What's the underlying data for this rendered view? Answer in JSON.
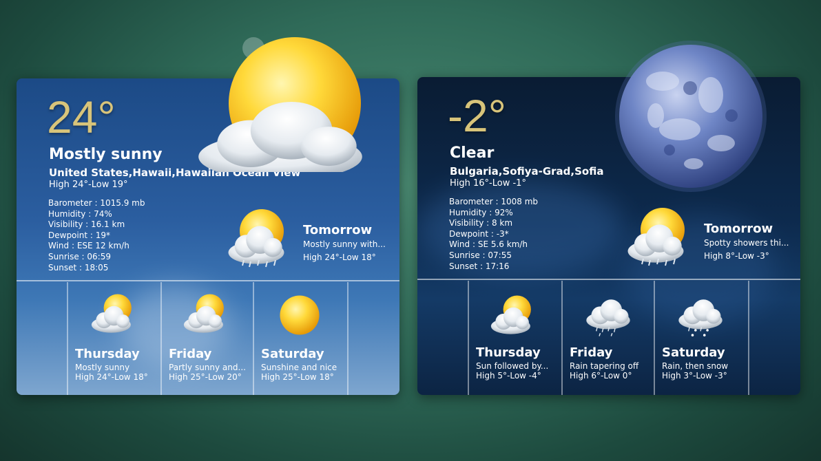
{
  "widgets": [
    {
      "temp": "24°",
      "condition": "Mostly sunny",
      "location": "United States,Hawaii,Hawaiian Ocean View",
      "high_low": "High 24°-Low 19°",
      "details": [
        "Barometer : 1015.9 mb",
        "Humidity : 74%",
        "Visibility : 16.1 km",
        "Dewpoint : 19*",
        "Wind : ESE 12 km/h",
        "Sunrise : 06:59",
        "Sunset : 18:05"
      ],
      "main_icon": "sun-cloud-icon",
      "tomorrow": {
        "title": "Tomorrow",
        "desc": "Mostly sunny with...",
        "high_low": "High 24°-Low 18°",
        "icon": "sun-cloud-rain-icon"
      },
      "forecast": [
        {
          "day": "Thursday",
          "desc": "Mostly sunny",
          "high_low": "High 24°-Low 18°",
          "icon": "sun-cloud-icon"
        },
        {
          "day": "Friday",
          "desc": "Partly sunny and...",
          "high_low": "High 25°-Low 20°",
          "icon": "sun-cloud-icon"
        },
        {
          "day": "Saturday",
          "desc": "Sunshine and nice",
          "high_low": "High 25°-Low 18°",
          "icon": "sun-icon"
        }
      ]
    },
    {
      "temp": "-2°",
      "condition": "Clear",
      "location": "Bulgaria,Sofiya-Grad,Sofia",
      "high_low": "High 16°-Low -1°",
      "details": [
        "Barometer : 1008 mb",
        "Humidity : 92%",
        "Visibility : 8 km",
        "Dewpoint : -3*",
        "Wind : SE 5.6 km/h",
        "Sunrise : 07:55",
        "Sunset : 17:16"
      ],
      "main_icon": "moon-icon",
      "tomorrow": {
        "title": "Tomorrow",
        "desc": "Spotty showers thi...",
        "high_low": "High 8°-Low -3°",
        "icon": "sun-cloud-rain-icon"
      },
      "forecast": [
        {
          "day": "Thursday",
          "desc": "Sun followed by...",
          "high_low": "High 5°-Low -4°",
          "icon": "sun-cloud-icon"
        },
        {
          "day": "Friday",
          "desc": "Rain tapering off",
          "high_low": "High 6°-Low 0°",
          "icon": "rain-cloud-icon"
        },
        {
          "day": "Saturday",
          "desc": "Rain, then snow",
          "high_low": "High 3°-Low -3°",
          "icon": "rain-snow-cloud-icon"
        }
      ]
    }
  ],
  "colors": {
    "temp": "#d8c47a",
    "day_panel": "#2b5ea0",
    "night_panel": "#0d2a4d",
    "background": "#2f6a58"
  }
}
